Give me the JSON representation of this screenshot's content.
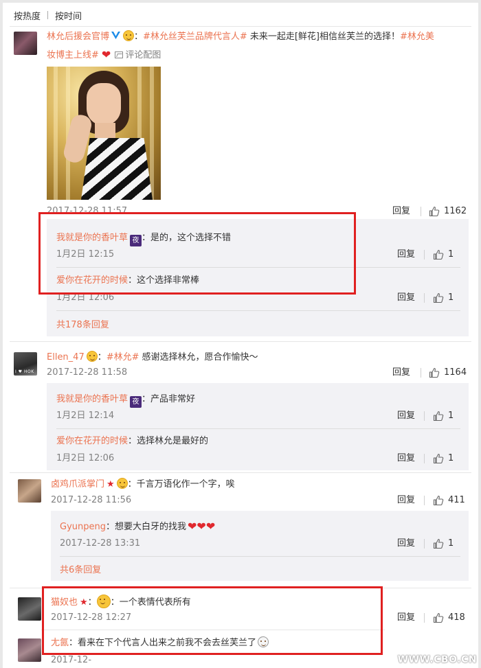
{
  "sort": {
    "hot": "按热度",
    "time": "按时间"
  },
  "actions": {
    "reply": "回复"
  },
  "comments": [
    {
      "user": "林允后援会官博",
      "text_parts": [
        "：",
        "#林允丝芙兰品牌代言人#",
        "未来一起走[鲜花]相信丝芙兰的选择！",
        "#林允美",
        "妆博主上线#"
      ],
      "pic_label": "评论配图",
      "time": "2017-12-28 11:57",
      "likes": "1162",
      "replies": [
        {
          "user": "我就是你的香叶草",
          "badge": "夜",
          "text": "：是的，这个选择不错",
          "time": "1月2日 12:15",
          "likes": "1"
        },
        {
          "user": "爱你在花开的时候",
          "text": "：这个选择非常棒",
          "time": "1月2日 12:06",
          "likes": "1"
        }
      ],
      "more": "共178条回复"
    },
    {
      "user": "Ellen_47",
      "avatar_caption": "I ♥ HOK",
      "text_parts": [
        "：",
        "#林允#",
        "感谢选择林允，愿合作愉快～"
      ],
      "time": "2017-12-28 11:58",
      "likes": "1164",
      "replies": [
        {
          "user": "我就是你的香叶草",
          "badge": "夜",
          "text": "：产品非常好",
          "time": "1月2日 12:14",
          "likes": "1"
        },
        {
          "user": "爱你在花开的时候",
          "text": "：选择林允是最好的",
          "time": "1月2日 12:06",
          "likes": "1"
        }
      ]
    },
    {
      "user": "卤鸡爪派掌门",
      "text": "：千言万语化作一个字，唉",
      "time": "2017-12-28 11:56",
      "likes": "411",
      "replies": [
        {
          "user": "Gyunpeng",
          "text": "：想要大白牙的找我",
          "time": "2017-12-28 13:31",
          "likes": "1"
        }
      ],
      "more": "共6条回复"
    },
    {
      "user": "猫奴也",
      "text": "：一个表情代表所有",
      "time": "2017-12-28 12:27",
      "likes": "418"
    },
    {
      "user": "尢氤",
      "text": "：看来在下个代言人出来之前我不会去丝芙兰了",
      "time": "2017-12-"
    }
  ],
  "watermark": "WWW.CBO.CN",
  "colors": {
    "link": "#eb7350",
    "highlight_box": "#e02020",
    "reply_bg": "#f2f2f5"
  }
}
